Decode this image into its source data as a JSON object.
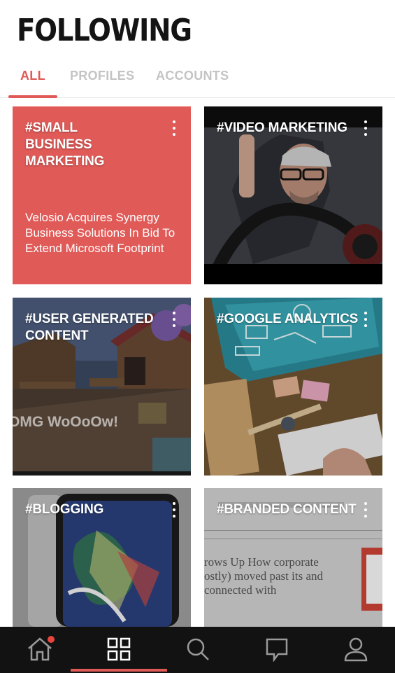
{
  "header": {
    "title": "FOLLOWING"
  },
  "tabs": [
    {
      "label": "ALL",
      "active": true
    },
    {
      "label": "PROFILES",
      "active": false
    },
    {
      "label": "ACCOUNTS",
      "active": false
    }
  ],
  "cards": [
    {
      "tag": "#SMALL BUSINESS MARKETING",
      "description": "Velosio Acquires Synergy Business Solutions In Bid To Extend Microsoft Footprint",
      "background": "#e05a57"
    },
    {
      "tag": "#VIDEO MARKETING",
      "image": "man-with-headphones-photo"
    },
    {
      "tag": "#USER GENERATED CONTENT",
      "image": "game-village-screenshot",
      "overlay_text": "OMG WoOoOw!"
    },
    {
      "tag": "#GOOGLE ANALYTICS",
      "image": "analytics-desk-photo"
    },
    {
      "tag": "#BLOGGING",
      "image": "tablet-photo"
    },
    {
      "tag": "#BRANDED CONTENT",
      "image": "magazine-article-photo",
      "article_text": "rows Up How corporate ostly) moved past its and connected with"
    }
  ],
  "bottom_nav": [
    {
      "name": "home",
      "icon": "home-icon",
      "badge": true
    },
    {
      "name": "following",
      "icon": "grid-icon",
      "active": true
    },
    {
      "name": "search",
      "icon": "search-icon"
    },
    {
      "name": "messages",
      "icon": "chat-icon"
    },
    {
      "name": "profile",
      "icon": "user-icon"
    }
  ],
  "colors": {
    "accent": "#e05a57",
    "nav_bg": "#121212",
    "tab_inactive": "#c4c4c4"
  }
}
